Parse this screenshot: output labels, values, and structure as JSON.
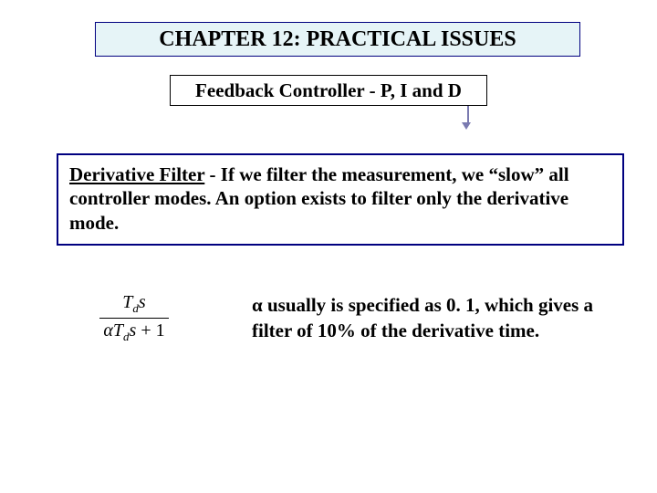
{
  "title": "CHAPTER 12: PRACTICAL ISSUES",
  "subtitle": "Feedback Controller - P, I and D",
  "body": {
    "heading": "Derivative Filter",
    "text": " - If we filter the measurement, we “slow” all controller modes.  An option exists to filter only the derivative mode."
  },
  "formula": {
    "numerator_html": "T<sub>d</sub>s",
    "denominator_html": "αT<sub>d</sub>s + 1"
  },
  "note": {
    "alpha": "α",
    "text": " usually is specified as 0. 1, which gives a filter of 10% of the derivative time."
  }
}
